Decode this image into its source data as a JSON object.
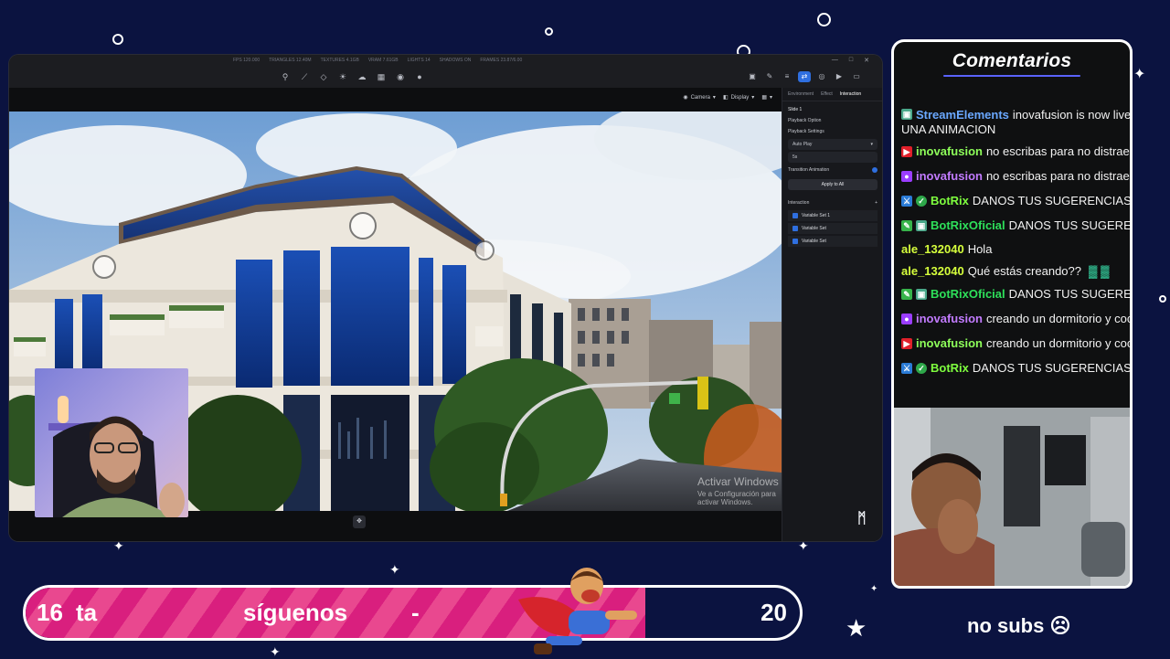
{
  "app": {
    "status_readouts": [
      "FPS 120.000",
      "TRIANGLES 12.40M",
      "TEXTURES 4.1GB",
      "VRAM 7.61GB",
      "LIGHTS 14",
      "SHADOWS ON",
      "FRAMES 23.87/6.00"
    ],
    "window_controls": [
      "—",
      "□",
      "✕"
    ],
    "toolbar_tools": [
      "pin-icon",
      "measure-icon",
      "cube-icon",
      "light-icon",
      "cloud-icon",
      "grid-icon",
      "camera-icon",
      "sphere-icon"
    ],
    "toolbar_right": [
      "image-icon",
      "edit-icon",
      "layers-icon",
      "interaction-icon",
      "capture-icon",
      "video-icon",
      "monitor-icon"
    ],
    "viewport_controls": {
      "camera": "Camera",
      "display": "Display"
    },
    "watermark": {
      "title": "Activar Windows",
      "subtitle": "Ve a Configuración para activar Windows."
    },
    "inspector": {
      "tabs": [
        "Environment",
        "Effect",
        "Interaction"
      ],
      "section_title": "Slide 1",
      "playback_option": "Playback Option",
      "playback_settings": "Playback Settings",
      "auto_play": "Auto Play",
      "duration": "5s",
      "transition_animation": "Transition Animation",
      "apply_all": "Apply to All",
      "interaction_label": "Interaction",
      "variables": [
        "Variable Set 1",
        "Variable Set",
        "Variable Set"
      ]
    }
  },
  "chat": {
    "title": "Comentarios",
    "system_line": "UNA ANIMACION",
    "messages": [
      {
        "user": "StreamElements",
        "text": "inovafusion is now live!",
        "color": "#6aa8ff",
        "badge": "#4aa88a"
      },
      {
        "user": "inovafusion",
        "text": "no escribas para no distraer",
        "color": "#8eff5a",
        "badge": "#e0202a"
      },
      {
        "user": "inovafusion",
        "text": "no escribas para no distraer",
        "color": "#c27bff",
        "badge": "#9b3dff"
      },
      {
        "user": "BotRix",
        "text": "DANOS TUS SUGERENCIAS.",
        "color": "#7fff3f",
        "badge": "#2a7bd6"
      },
      {
        "user": "BotRixOficial",
        "text": "DANOS TUS SUGERENCIAS.",
        "color": "#2ee05a",
        "badge": "#37b34a"
      },
      {
        "user": "ale_132040",
        "text": "Hola",
        "color": "#d6ff3c",
        "badge": ""
      },
      {
        "user": "ale_132040",
        "text": "Qué estás creando??",
        "color": "#d6ff3c",
        "badge": ""
      },
      {
        "user": "BotRixOficial",
        "text": "DANOS TUS SUGERENCIAS.",
        "color": "#2ee05a",
        "badge": "#37b34a"
      },
      {
        "user": "inovafusion",
        "text": "creando un dormitorio y cocina",
        "color": "#c27bff",
        "badge": "#9b3dff"
      },
      {
        "user": "inovafusion",
        "text": "creando un dormitorio y cocina",
        "color": "#8eff5a",
        "badge": "#e0202a"
      },
      {
        "user": "BotRix",
        "text": "DANOS TUS SUGERENCIAS.",
        "color": "#7fff3f",
        "badge": "#2a7bd6"
      }
    ]
  },
  "goal": {
    "start": "16",
    "word1": "ta",
    "word2": "síguenos",
    "dash": "-",
    "target": "20",
    "progress": 0.8
  },
  "subs": {
    "label": "no subs ☹"
  }
}
